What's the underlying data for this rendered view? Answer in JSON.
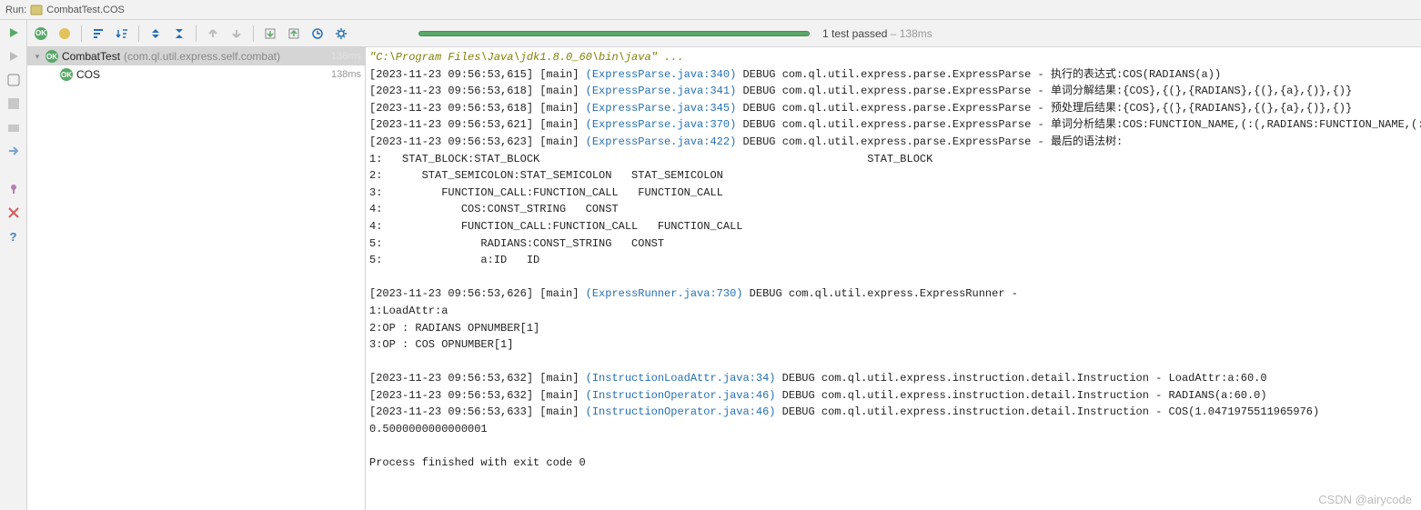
{
  "header": {
    "run_label": "Run:",
    "config_icon": "run-config-icon",
    "config_name": "CombatTest.COS"
  },
  "toolbar": {
    "ok_badge": "OK",
    "items": [
      "show-passed",
      "sort",
      "layout",
      "expand",
      "collapse",
      "prev",
      "next",
      "import",
      "export",
      "history",
      "settings"
    ]
  },
  "progress": {
    "summary_passed": "1 test passed",
    "summary_dash": " – ",
    "summary_duration": "138ms"
  },
  "tree": {
    "root": {
      "name": "CombatTest",
      "pkg": "(com.ql.util.express.self.combat)",
      "time": "138ms",
      "time_color": "#e0e0e0"
    },
    "child": {
      "name": "COS",
      "time": "138ms",
      "time_color": "#999"
    }
  },
  "console": {
    "cmd": "\"C:\\Program Files\\Java\\jdk1.8.0_60\\bin\\java\" ...",
    "lines": [
      "[2023-11-23 09:56:53,615] [main] (ExpressParse.java:340) DEBUG com.ql.util.express.parse.ExpressParse - 执行的表达式:COS(RADIANS(a))",
      "[2023-11-23 09:56:53,618] [main] (ExpressParse.java:341) DEBUG com.ql.util.express.parse.ExpressParse - 单词分解结果:{COS},{(},{RADIANS},{(},{a},{)},{)}",
      "[2023-11-23 09:56:53,618] [main] (ExpressParse.java:345) DEBUG com.ql.util.express.parse.ExpressParse - 预处理后结果:{COS},{(},{RADIANS},{(},{a},{)},{)}",
      "[2023-11-23 09:56:53,621] [main] (ExpressParse.java:370) DEBUG com.ql.util.express.parse.ExpressParse - 单词分析结果:COS:FUNCTION_NAME,(:(,RADIANS:FUNCTION_NAME,(:(,a:ID,):),):)",
      "[2023-11-23 09:56:53,623] [main] (ExpressParse.java:422) DEBUG com.ql.util.express.parse.ExpressParse - 最后的语法树:",
      "1:   STAT_BLOCK:STAT_BLOCK                                                  STAT_BLOCK",
      "2:      STAT_SEMICOLON:STAT_SEMICOLON   STAT_SEMICOLON",
      "3:         FUNCTION_CALL:FUNCTION_CALL   FUNCTION_CALL",
      "4:            COS:CONST_STRING   CONST",
      "4:            FUNCTION_CALL:FUNCTION_CALL   FUNCTION_CALL",
      "5:               RADIANS:CONST_STRING   CONST",
      "5:               a:ID   ID",
      "",
      "[2023-11-23 09:56:53,626] [main] (ExpressRunner.java:730) DEBUG com.ql.util.express.ExpressRunner - ",
      "1:LoadAttr:a",
      "2:OP : RADIANS OPNUMBER[1]",
      "3:OP : COS OPNUMBER[1]",
      "",
      "[2023-11-23 09:56:53,632] [main] (InstructionLoadAttr.java:34) DEBUG com.ql.util.express.instruction.detail.Instruction - LoadAttr:a:60.0",
      "[2023-11-23 09:56:53,632] [main] (InstructionOperator.java:46) DEBUG com.ql.util.express.instruction.detail.Instruction - RADIANS(a:60.0)",
      "[2023-11-23 09:56:53,633] [main] (InstructionOperator.java:46) DEBUG com.ql.util.express.instruction.detail.Instruction - COS(1.0471975511965976)",
      "0.5000000000000001",
      ""
    ],
    "exit_line": "Process finished with exit code 0"
  },
  "footer": {
    "watermark": "CSDN @airycode"
  },
  "colors": {
    "green": "#59a869",
    "link": "#2470b3",
    "cmd": "#808000"
  }
}
